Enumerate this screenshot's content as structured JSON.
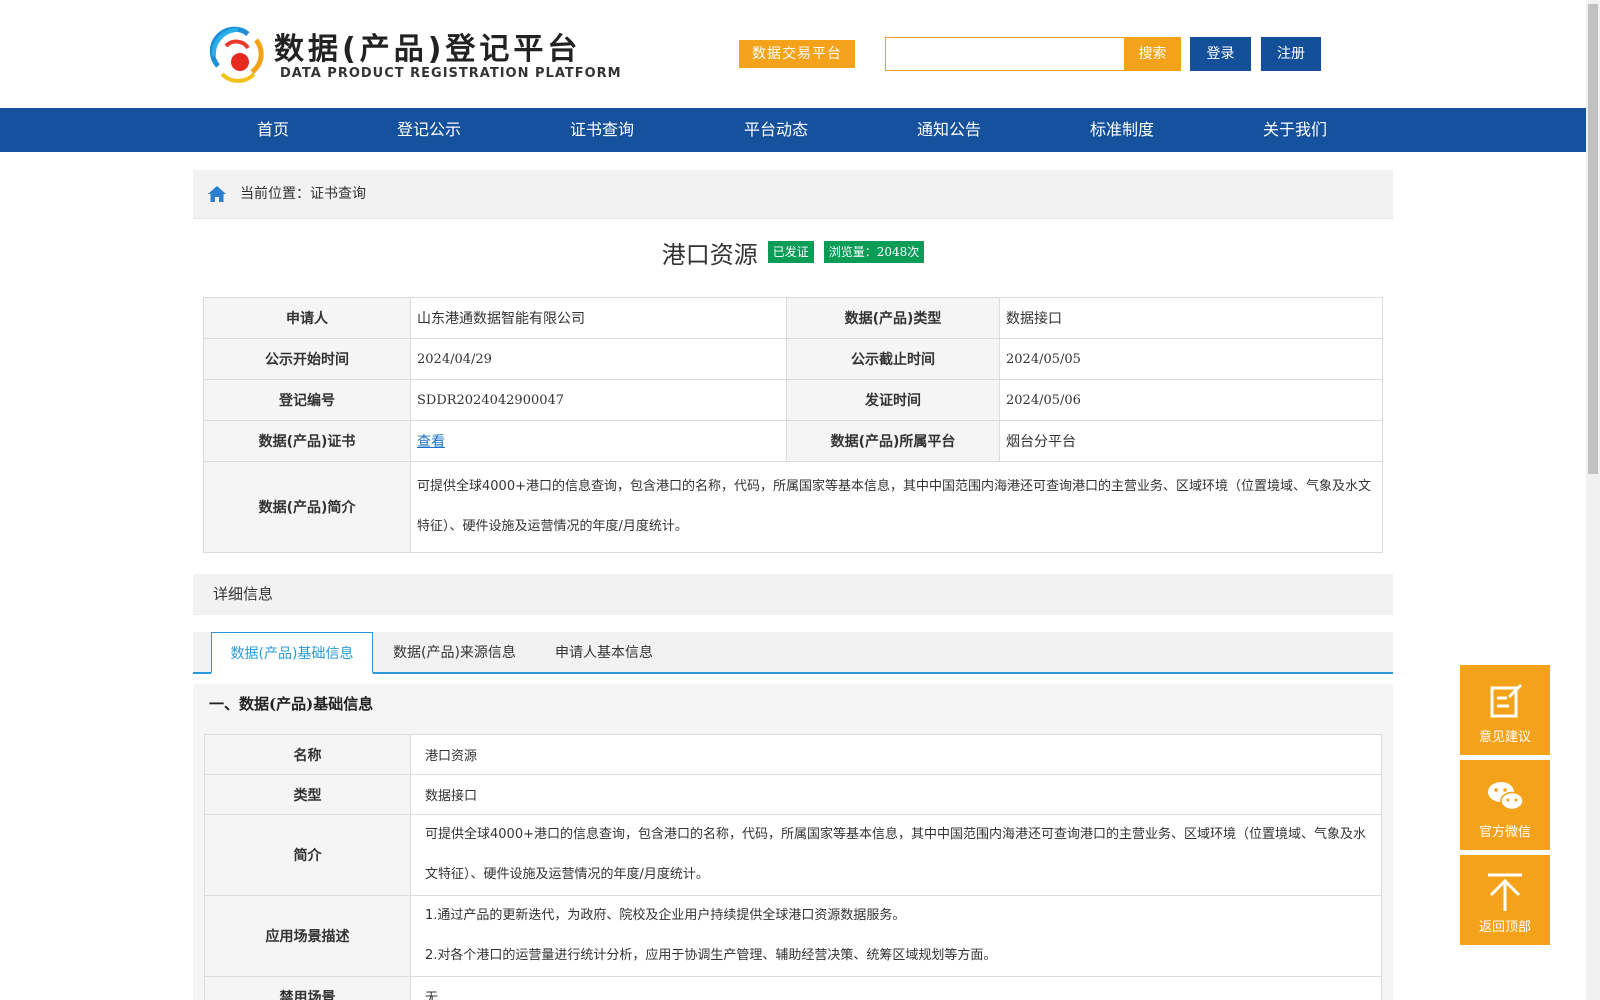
{
  "header": {
    "logo_cn": "数据(产品)登记平台",
    "logo_en": "DATA PRODUCT REGISTRATION PLATFORM",
    "trade_label": "数据交易平台",
    "search_value": "",
    "search_label": "搜索",
    "login_label": "登录",
    "register_label": "注册"
  },
  "nav": [
    "首页",
    "登记公示",
    "证书查询",
    "平台动态",
    "通知公告",
    "标准制度",
    "关于我们"
  ],
  "breadcrumb": "当前位置：证书查询",
  "product": {
    "title": "港口资源",
    "status": "已发证",
    "views": "浏览量：2048次"
  },
  "info": {
    "applicant_label": "申请人",
    "applicant": "山东港通数据智能有限公司",
    "type_label": "数据(产品)类型",
    "type": "数据接口",
    "start_label": "公示开始时间",
    "start": "2024/04/29",
    "end_label": "公示截止时间",
    "end": "2024/05/05",
    "regno_label": "登记编号",
    "regno": "SDDR2024042900047",
    "issue_label": "发证时间",
    "issue": "2024/05/06",
    "cert_label": "数据(产品)证书",
    "cert_link": "查看",
    "platform_label": "数据(产品)所属平台",
    "platform": "烟台分平台",
    "intro_label": "数据(产品)简介",
    "intro": "可提供全球4000+港口的信息查询，包含港口的名称，代码，所属国家等基本信息，其中中国范围内海港还可查询港口的主营业务、区域环境（位置境域、气象及水文特征）、硬件设施及运营情况的年度/月度统计。"
  },
  "detail_label": "详细信息",
  "tabs": [
    "数据(产品)基础信息",
    "数据(产品)来源信息",
    "申请人基本信息"
  ],
  "section": {
    "title": "一、数据(产品)基础信息",
    "name_label": "名称",
    "name": "港口资源",
    "type_label": "类型",
    "type": "数据接口",
    "intro_label": "简介",
    "intro": "可提供全球4000+港口的信息查询，包含港口的名称，代码，所属国家等基本信息，其中中国范围内海港还可查询港口的主营业务、区域环境（位置境域、气象及水文特征）、硬件设施及运营情况的年度/月度统计。",
    "scenario_label": "应用场景描述",
    "scenario_1": "1.通过产品的更新迭代，为政府、院校及企业用户持续提供全球港口资源数据服务。",
    "scenario_2": "2.对各个港口的运营量进行统计分析，应用于协调生产管理、辅助经营决策、统筹区域规划等方面。",
    "forbidden_label": "禁用场景",
    "forbidden": "无"
  },
  "float": {
    "feedback": "意见建议",
    "wechat": "官方微信",
    "top": "返回顶部"
  }
}
